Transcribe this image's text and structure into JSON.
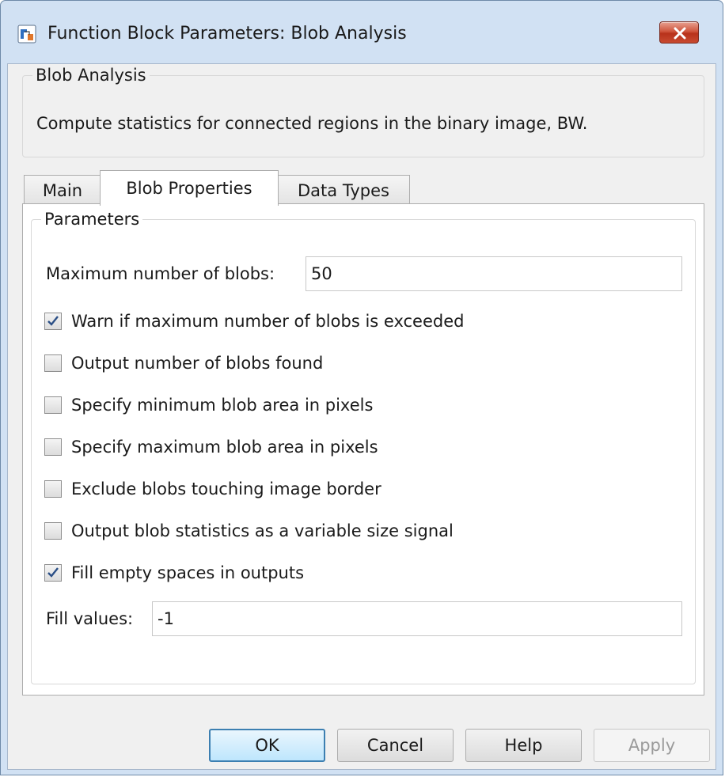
{
  "window": {
    "title": "Function Block Parameters: Blob Analysis"
  },
  "description": {
    "group_title": "Blob Analysis",
    "text": "Compute statistics for connected regions in the binary image, BW."
  },
  "tabs": [
    {
      "label": "Main",
      "active": false
    },
    {
      "label": "Blob Properties",
      "active": true
    },
    {
      "label": "Data Types",
      "active": false
    }
  ],
  "parameters": {
    "group_title": "Parameters",
    "max_blobs": {
      "label": "Maximum number of blobs:",
      "value": "50"
    },
    "checkboxes": [
      {
        "label": "Warn if maximum number of blobs is exceeded",
        "checked": true
      },
      {
        "label": "Output number of blobs found",
        "checked": false
      },
      {
        "label": "Specify minimum blob area in pixels",
        "checked": false
      },
      {
        "label": "Specify maximum blob area in pixels",
        "checked": false
      },
      {
        "label": "Exclude blobs touching image border",
        "checked": false
      },
      {
        "label": "Output blob statistics as a variable size signal",
        "checked": false
      },
      {
        "label": "Fill empty spaces in outputs",
        "checked": true
      }
    ],
    "fill_values": {
      "label": "Fill values:",
      "value": "-1"
    }
  },
  "buttons": {
    "ok": "OK",
    "cancel": "Cancel",
    "help": "Help",
    "apply": "Apply"
  },
  "colors": {
    "title_bar": "#d1e1f3",
    "close_button": "#c84a30",
    "default_button_border": "#3c7fb1",
    "checkmark": "#2b4f86"
  }
}
